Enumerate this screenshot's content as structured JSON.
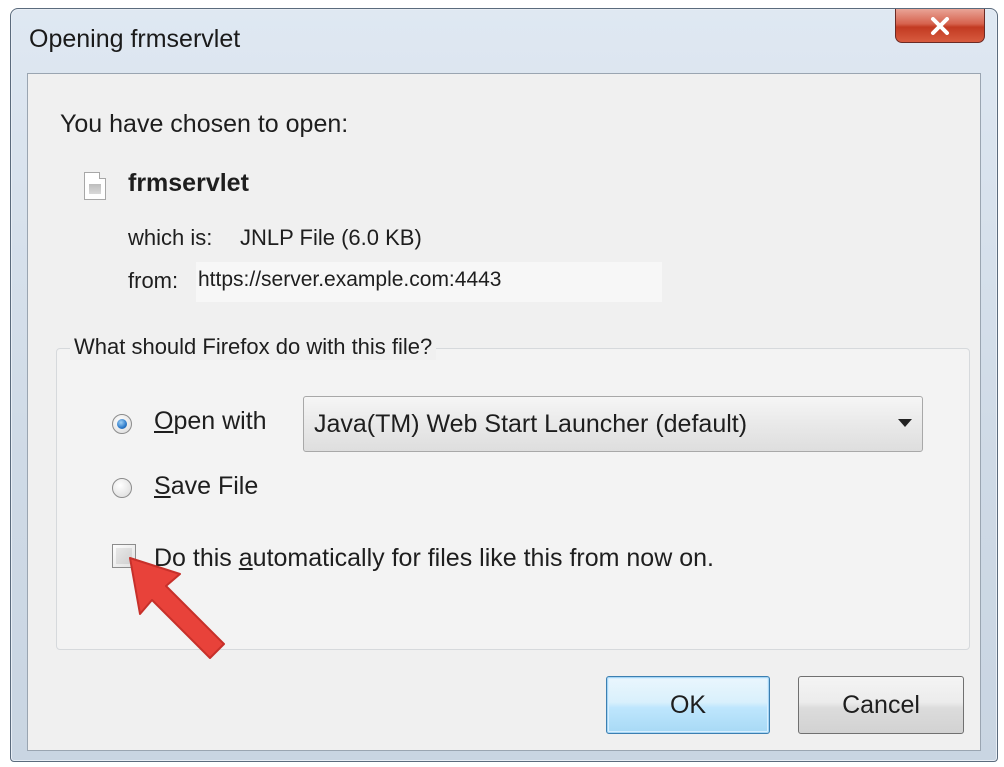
{
  "window": {
    "title": "Opening frmservlet",
    "close_icon": "close-icon"
  },
  "info": {
    "intro": "You have chosen to open:",
    "file_icon": "file-icon",
    "filename": "frmservlet",
    "which_label": "which is:",
    "which_value": "JNLP File (6.0 KB)",
    "from_label": "from:",
    "from_value": "https://server.example.com:4443"
  },
  "action": {
    "question": "What should Firefox do with this file?",
    "open_with": {
      "prefix": "",
      "mnemonic": "O",
      "rest": "pen with",
      "checked": true
    },
    "app_select": {
      "value": "Java(TM) Web Start Launcher (default)",
      "icon": "chevron-down-icon"
    },
    "save_file": {
      "mnemonic": "S",
      "rest": "ave File",
      "checked": false
    },
    "auto": {
      "before": "Do this ",
      "mnemonic": "a",
      "after": "utomatically for files like this from now on.",
      "checked": false
    }
  },
  "annotation": {
    "arrow_icon": "red-arrow-icon",
    "color": "#e8423a"
  },
  "buttons": {
    "ok": "OK",
    "cancel": "Cancel"
  }
}
